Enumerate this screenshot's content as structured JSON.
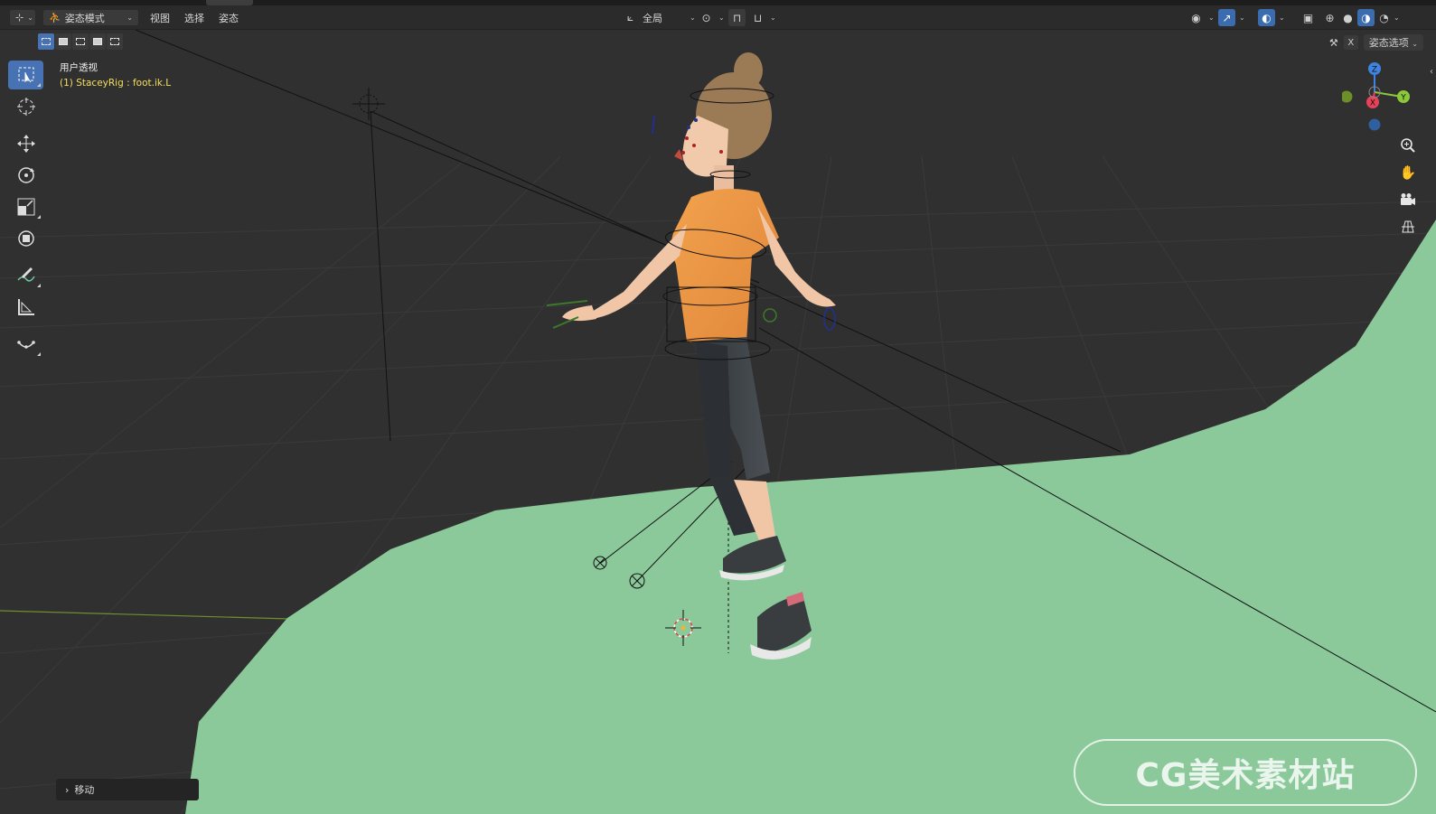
{
  "header": {
    "mode_label": "姿态模式",
    "menus": [
      "视图",
      "选择",
      "姿态"
    ],
    "transform_orientation": "全局",
    "pose_options_label": "姿态选项",
    "x_axis_label": "X"
  },
  "viewport": {
    "view_title": "用户透视",
    "active_object": "(1) StaceyRig : foot.ik.L"
  },
  "gizmo": {
    "z_label": "Z",
    "y_label": "Y",
    "x_label": "X",
    "colors": {
      "x": "#e8415a",
      "y": "#8cc83a",
      "z": "#3f83e0",
      "y_neg": "#6d8f2a",
      "z_neg": "#2f5f9e"
    }
  },
  "tools": [
    {
      "name": "select-box",
      "icon": "select-box-icon"
    },
    {
      "name": "cursor",
      "icon": "cursor-icon"
    },
    {
      "name": "move",
      "icon": "move-icon"
    },
    {
      "name": "rotate",
      "icon": "rotate-icon"
    },
    {
      "name": "scale",
      "icon": "scale-icon"
    },
    {
      "name": "transform",
      "icon": "transform-icon"
    },
    {
      "name": "annotate",
      "icon": "annotate-icon"
    },
    {
      "name": "measure",
      "icon": "measure-icon"
    },
    {
      "name": "bone-relax",
      "icon": "relax-icon"
    }
  ],
  "last_operator": {
    "label": "移动"
  },
  "watermark": {
    "text": "CG美术素材站"
  },
  "colors": {
    "ground_plane": "#8bc99a",
    "grid_background": "#303030",
    "accent_blue": "#4772b3",
    "active_object_text": "#f6df5e"
  }
}
